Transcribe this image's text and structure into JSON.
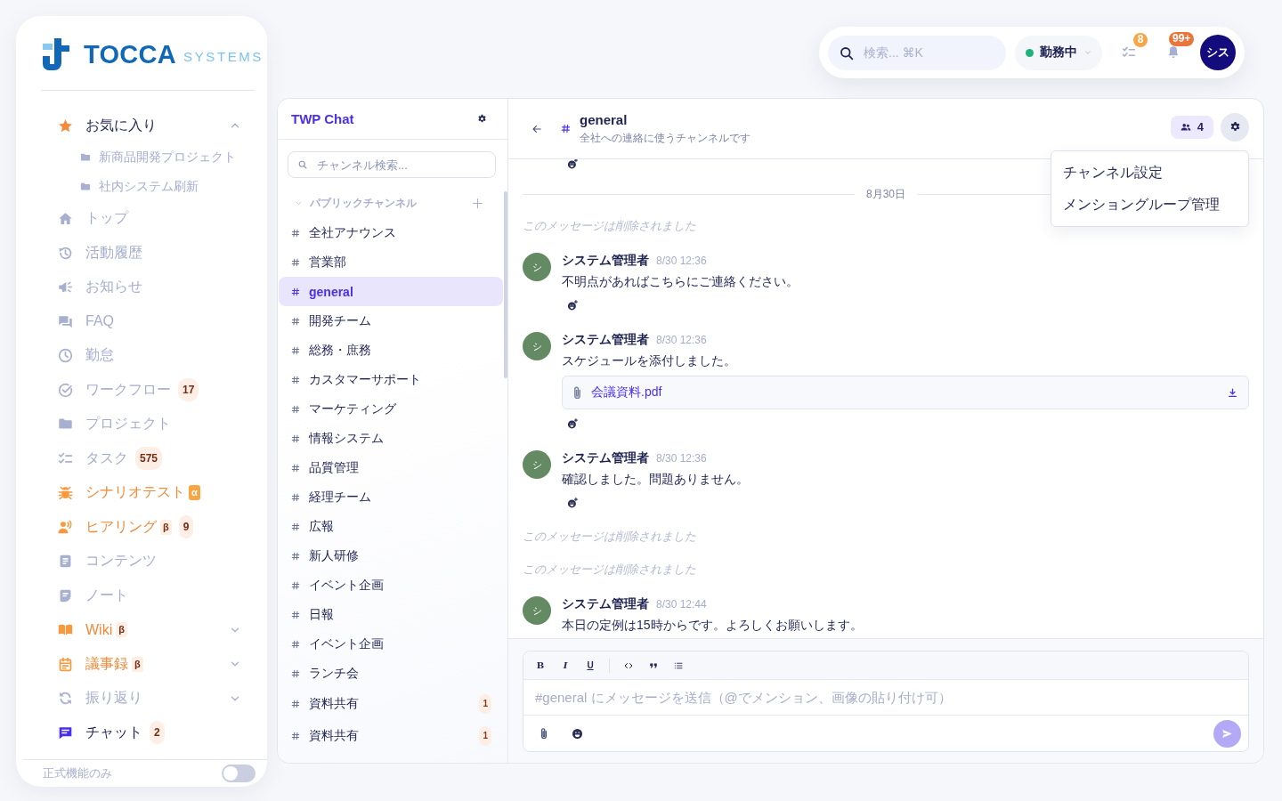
{
  "logo": {
    "name": "TOCCA",
    "suffix": "SYSTEMS"
  },
  "sidebar": {
    "items": [
      {
        "kind": "group",
        "label": "お気に入り",
        "selected": false,
        "expanded": true,
        "children": [
          {
            "label": "新商品開発プロジェクト",
            "selected": false
          },
          {
            "label": "社内システム刷新",
            "selected": false
          }
        ]
      },
      {
        "kind": "link",
        "label": "トップ",
        "selected": false
      },
      {
        "kind": "link",
        "label": "活動履歴",
        "selected": false
      },
      {
        "kind": "link",
        "label": "お知らせ",
        "selected": false
      },
      {
        "kind": "link",
        "label": "FAQ",
        "selected": false
      },
      {
        "kind": "link",
        "label": "勤怠",
        "selected": false
      },
      {
        "kind": "link",
        "label": "ワークフロー",
        "selected": false,
        "count": "17"
      },
      {
        "kind": "link",
        "label": "プロジェクト",
        "selected": false
      },
      {
        "kind": "link",
        "label": "タスク",
        "selected": false,
        "count": "575"
      },
      {
        "kind": "link",
        "label": "シナリオテスト",
        "selected": false,
        "tag": {
          "label": "α",
          "kind": "alpha"
        }
      },
      {
        "kind": "link",
        "label": "ヒアリング",
        "selected": false,
        "tag": {
          "label": "β",
          "kind": "beta"
        },
        "count": "9"
      },
      {
        "kind": "link",
        "label": "コンテンツ",
        "selected": false
      },
      {
        "kind": "link",
        "label": "ノート",
        "selected": false
      },
      {
        "kind": "group",
        "label": "Wiki",
        "selected": false,
        "tag": {
          "label": "β",
          "kind": "beta"
        },
        "expanded": false
      },
      {
        "kind": "group",
        "label": "議事録",
        "selected": false,
        "tag": {
          "label": "β",
          "kind": "beta"
        },
        "expanded": false
      },
      {
        "kind": "group",
        "label": "振り返り",
        "selected": false,
        "expanded": false
      },
      {
        "kind": "link",
        "label": "チャット",
        "selected": true,
        "count": "2"
      }
    ],
    "footer": {
      "label": "正式機能のみ",
      "on": false
    }
  },
  "top_bar": {
    "search": {
      "placeholder": "検索... ⌘K"
    },
    "status": {
      "label": "勤務中"
    },
    "tasks_badge": "8",
    "notifications_badge": "99+",
    "avatar": "シス"
  },
  "channels": {
    "title": "TWP Chat",
    "search": {
      "placeholder": "チャンネル検索..."
    },
    "sections": [
      {
        "label": "パブリックチャンネル",
        "expanded": true,
        "items": [
          {
            "name": "全社アナウンス",
            "selected": false
          },
          {
            "name": "営業部",
            "selected": false
          },
          {
            "name": "general",
            "selected": true
          },
          {
            "name": "開発チーム",
            "selected": false
          },
          {
            "name": "総務・庶務",
            "selected": false
          },
          {
            "name": "カスタマーサポート",
            "selected": false
          },
          {
            "name": "マーケティング",
            "selected": false
          },
          {
            "name": "情報システム",
            "selected": false
          },
          {
            "name": "品質管理",
            "selected": false
          },
          {
            "name": "経理チーム",
            "selected": false
          },
          {
            "name": "広報",
            "selected": false
          },
          {
            "name": "新人研修",
            "selected": false
          },
          {
            "name": "イベント企画",
            "selected": false
          },
          {
            "name": "日報",
            "selected": false
          },
          {
            "name": "イベント企画",
            "selected": false
          },
          {
            "name": "ランチ会",
            "selected": false
          },
          {
            "name": "資料共有",
            "selected": false,
            "unread": "1"
          },
          {
            "name": "資料共有",
            "selected": false,
            "unread": "1"
          }
        ]
      }
    ]
  },
  "chat": {
    "channel": {
      "name": "general",
      "description": "全社への連絡に使うチャンネルです",
      "members": "4"
    },
    "settings_menu": {
      "open": true,
      "items": [
        "チャンネル設定",
        "メンショングループ管理"
      ]
    },
    "messages": [
      {
        "kind": "reaction_bar"
      },
      {
        "kind": "date",
        "label": "8月30日"
      },
      {
        "kind": "deleted",
        "text": "このメッセージは削除されました"
      },
      {
        "kind": "message",
        "author": "システム管理者",
        "avatar": "シ",
        "time": "8/30 12:36",
        "text": "不明点があればこちらにご連絡ください。",
        "add_reaction": true
      },
      {
        "kind": "message",
        "author": "システム管理者",
        "avatar": "シ",
        "time": "8/30 12:36",
        "text": "スケジュールを添付しました。",
        "attachment": "会議資料.pdf",
        "add_reaction": true
      },
      {
        "kind": "message",
        "author": "システム管理者",
        "avatar": "シ",
        "time": "8/30 12:36",
        "text": "確認しました。問題ありません。",
        "add_reaction": true
      },
      {
        "kind": "deleted",
        "text": "このメッセージは削除されました"
      },
      {
        "kind": "deleted",
        "text": "このメッセージは削除されました"
      },
      {
        "kind": "message",
        "author": "システム管理者",
        "avatar": "シ",
        "time": "8/30 12:44",
        "text": "本日の定例は15時からです。よろしくお願いします。",
        "add_reaction": false
      }
    ],
    "composer": {
      "format_buttons": [
        "B",
        "I",
        "U"
      ],
      "placeholder": "#general にメッセージを送信（@でメンション、画像の貼り付け可）",
      "send_button": {
        "disabled": true
      }
    }
  }
}
